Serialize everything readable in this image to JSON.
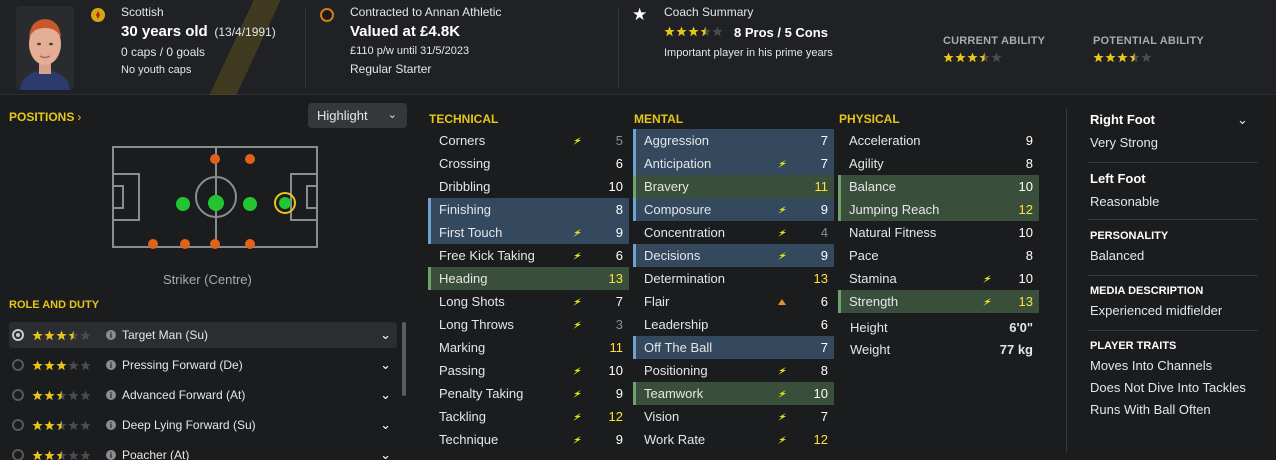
{
  "header": {
    "nationality": "Scottish",
    "age": "30 years old",
    "dob": "(13/4/1991)",
    "caps": "0 caps / 0 goals",
    "youth": "No youth caps",
    "contract_club": "Contracted to Annan Athletic",
    "value": "Valued at £4.8K",
    "wage": "£110 p/w until 31/5/2023",
    "status": "Regular Starter",
    "coach_title": "Coach Summary",
    "pros_cons": "8 Pros / 5 Cons",
    "coach_note": "Important player in his prime years",
    "coach_stars": 3.5,
    "ca_label": "CURRENT ABILITY",
    "pa_label": "POTENTIAL ABILITY",
    "ca_stars": 3.5,
    "pa_stars": 3.5
  },
  "positions": {
    "title": "POSITIONS",
    "highlight": "Highlight",
    "position_label": "Striker (Centre)"
  },
  "role_duty": {
    "title": "ROLE AND DUTY",
    "roles": [
      {
        "name": "Target Man (Su)",
        "stars": 3.5,
        "selected": true
      },
      {
        "name": "Pressing Forward (De)",
        "stars": 3,
        "selected": false
      },
      {
        "name": "Advanced Forward (At)",
        "stars": 2.5,
        "selected": false
      },
      {
        "name": "Deep Lying Forward (Su)",
        "stars": 2.5,
        "selected": false
      },
      {
        "name": "Poacher (At)",
        "stars": 2.5,
        "selected": false
      }
    ]
  },
  "technical": {
    "title": "TECHNICAL",
    "attrs": [
      {
        "name": "Corners",
        "value": "5",
        "hl": "",
        "arrow": "up"
      },
      {
        "name": "Crossing",
        "value": "6",
        "hl": "",
        "arrow": ""
      },
      {
        "name": "Dribbling",
        "value": "10",
        "hl": "",
        "arrow": ""
      },
      {
        "name": "Finishing",
        "value": "8",
        "hl": "blue",
        "arrow": ""
      },
      {
        "name": "First Touch",
        "value": "9",
        "hl": "blue",
        "arrow": "up"
      },
      {
        "name": "Free Kick Taking",
        "value": "6",
        "hl": "",
        "arrow": "up"
      },
      {
        "name": "Heading",
        "value": "13",
        "hl": "green",
        "arrow": ""
      },
      {
        "name": "Long Shots",
        "value": "7",
        "hl": "",
        "arrow": "up"
      },
      {
        "name": "Long Throws",
        "value": "3",
        "hl": "",
        "arrow": "up"
      },
      {
        "name": "Marking",
        "value": "11",
        "hl": "",
        "arrow": ""
      },
      {
        "name": "Passing",
        "value": "10",
        "hl": "",
        "arrow": "up"
      },
      {
        "name": "Penalty Taking",
        "value": "9",
        "hl": "",
        "arrow": "up"
      },
      {
        "name": "Tackling",
        "value": "12",
        "hl": "",
        "arrow": "up"
      },
      {
        "name": "Technique",
        "value": "9",
        "hl": "",
        "arrow": "up"
      }
    ]
  },
  "mental": {
    "title": "MENTAL",
    "attrs": [
      {
        "name": "Aggression",
        "value": "7",
        "hl": "blue",
        "arrow": ""
      },
      {
        "name": "Anticipation",
        "value": "7",
        "hl": "blue",
        "arrow": "up"
      },
      {
        "name": "Bravery",
        "value": "11",
        "hl": "green",
        "arrow": ""
      },
      {
        "name": "Composure",
        "value": "9",
        "hl": "blue",
        "arrow": "up"
      },
      {
        "name": "Concentration",
        "value": "4",
        "hl": "",
        "arrow": "up"
      },
      {
        "name": "Decisions",
        "value": "9",
        "hl": "blue",
        "arrow": "up"
      },
      {
        "name": "Determination",
        "value": "13",
        "hl": "",
        "arrow": ""
      },
      {
        "name": "Flair",
        "value": "6",
        "hl": "",
        "arrow": "orange"
      },
      {
        "name": "Leadership",
        "value": "6",
        "hl": "",
        "arrow": ""
      },
      {
        "name": "Off The Ball",
        "value": "7",
        "hl": "blue",
        "arrow": ""
      },
      {
        "name": "Positioning",
        "value": "8",
        "hl": "",
        "arrow": "up"
      },
      {
        "name": "Teamwork",
        "value": "10",
        "hl": "green",
        "arrow": "up"
      },
      {
        "name": "Vision",
        "value": "7",
        "hl": "",
        "arrow": "up"
      },
      {
        "name": "Work Rate",
        "value": "12",
        "hl": "",
        "arrow": "up"
      }
    ]
  },
  "physical": {
    "title": "PHYSICAL",
    "attrs": [
      {
        "name": "Acceleration",
        "value": "9",
        "hl": "",
        "arrow": ""
      },
      {
        "name": "Agility",
        "value": "8",
        "hl": "",
        "arrow": ""
      },
      {
        "name": "Balance",
        "value": "10",
        "hl": "green",
        "arrow": ""
      },
      {
        "name": "Jumping Reach",
        "value": "12",
        "hl": "green",
        "arrow": ""
      },
      {
        "name": "Natural Fitness",
        "value": "10",
        "hl": "",
        "arrow": ""
      },
      {
        "name": "Pace",
        "value": "8",
        "hl": "",
        "arrow": ""
      },
      {
        "name": "Stamina",
        "value": "10",
        "hl": "",
        "arrow": "up"
      },
      {
        "name": "Strength",
        "value": "13",
        "hl": "green",
        "arrow": "up"
      }
    ],
    "height_label": "Height",
    "height": "6'0\"",
    "weight_label": "Weight",
    "weight": "77 kg"
  },
  "profile": {
    "right_foot_label": "Right Foot",
    "right_foot": "Very Strong",
    "left_foot_label": "Left Foot",
    "left_foot": "Reasonable",
    "personality_label": "PERSONALITY",
    "personality": "Balanced",
    "media_label": "MEDIA DESCRIPTION",
    "media": "Experienced midfielder",
    "traits_label": "PLAYER TRAITS",
    "traits": [
      "Moves Into Channels",
      "Does Not Dive Into Tackles",
      "Runs With Ball Often"
    ]
  },
  "colors": {
    "accent": "#e6c619",
    "blue_hl": "#34495e",
    "green_hl": "#3a4f3b",
    "pos_green": "#22c531",
    "pos_orange": "#e0621a"
  }
}
